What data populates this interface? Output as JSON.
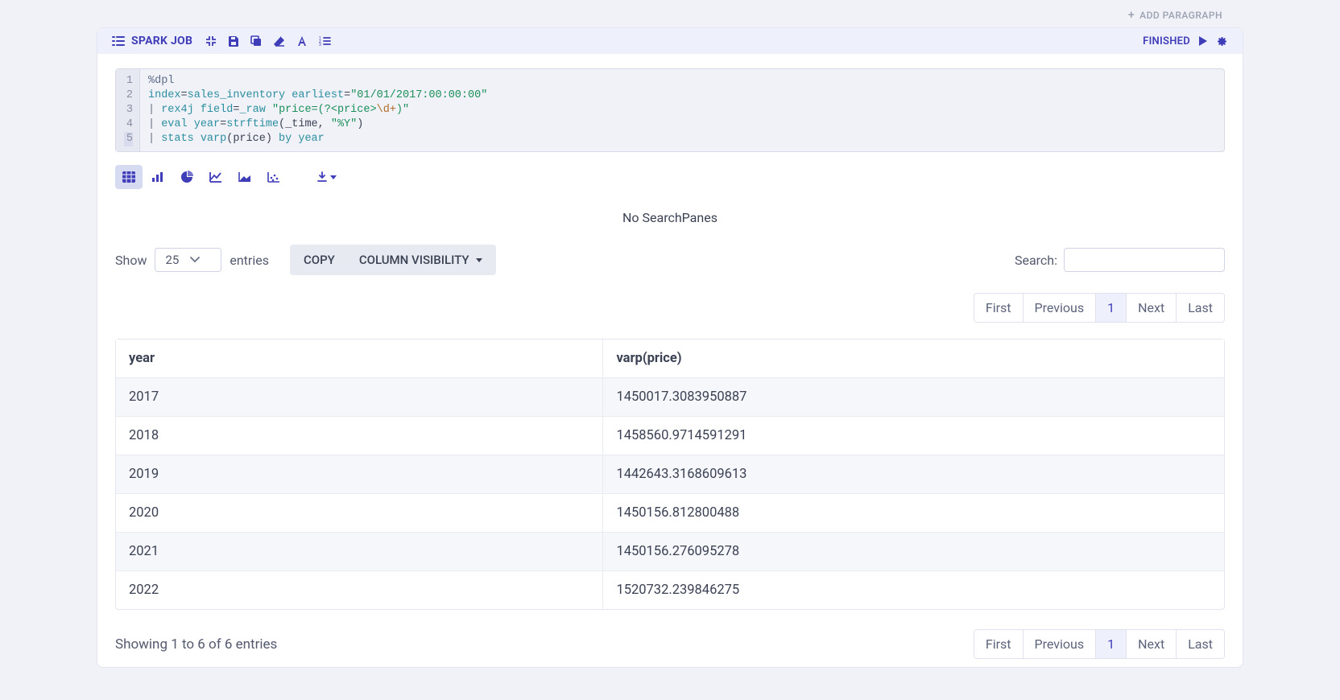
{
  "addParagraph": "ADD PARAGRAPH",
  "cell": {
    "title": "SPARK JOB",
    "status": "FINISHED",
    "code": {
      "lineNumbers": [
        "1",
        "2",
        "3",
        "4",
        "5"
      ],
      "l1_dir": "%dpl",
      "l2_a": "index",
      "l2_eq1": "=",
      "l2_b": "sales_inventory",
      "l2_sp": " ",
      "l2_c": "earliest",
      "l2_eq2": "=",
      "l2_d": "\"01/01/2017:00:00:00\"",
      "l3_pipe": "| ",
      "l3_a": "rex4j",
      "l3_sp1": " ",
      "l3_b": "field",
      "l3_eq": "=",
      "l3_c": "_raw",
      "l3_sp2": " ",
      "l3_d_open": "\"price=(?<price>",
      "l3_esc": "\\d+",
      "l3_d_close": ")\"",
      "l4_pipe": "| ",
      "l4_a": "eval",
      "l4_sp1": " ",
      "l4_b": "year",
      "l4_eq": "=",
      "l4_c": "strftime",
      "l4_paren": "(_time, ",
      "l4_d": "\"%Y\"",
      "l4_close": ")",
      "l5_pipe": "| ",
      "l5_a": "stats",
      "l5_sp1": " ",
      "l5_b": "varp",
      "l5_paren": "(price) ",
      "l5_c": "by",
      "l5_sp2": " ",
      "l5_d": "year"
    }
  },
  "noSearchPanes": "No SearchPanes",
  "lengthMenu": {
    "show": "Show",
    "value": "25",
    "entries": "entries"
  },
  "buttons": {
    "copy": "COPY",
    "colvis": "COLUMN VISIBILITY"
  },
  "search": {
    "label": "Search:"
  },
  "pager": {
    "first": "First",
    "prev": "Previous",
    "page": "1",
    "next": "Next",
    "last": "Last"
  },
  "table": {
    "columns": [
      "year",
      "varp(price)"
    ],
    "rows": [
      [
        "2017",
        "1450017.3083950887"
      ],
      [
        "2018",
        "1458560.9714591291"
      ],
      [
        "2019",
        "1442643.3168609613"
      ],
      [
        "2020",
        "1450156.812800488"
      ],
      [
        "2021",
        "1450156.276095278"
      ],
      [
        "2022",
        "1520732.239846275"
      ]
    ]
  },
  "showing": "Showing 1 to 6 of 6 entries"
}
